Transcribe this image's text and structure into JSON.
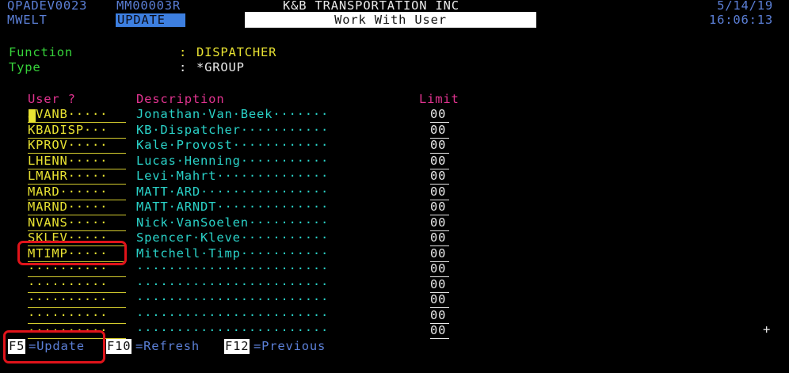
{
  "header": {
    "system_id": "QPADEV0023",
    "program_id": "MM00003R",
    "company": "K&B TRANSPORTATION INC",
    "date": "5/14/19",
    "user_id": "MWELT",
    "mode": "UPDATE",
    "screen_title": "Work With User",
    "time": "16:06:13"
  },
  "function": {
    "label": "Function",
    "colon": ":",
    "value": "DISPATCHER"
  },
  "type": {
    "label": "Type",
    "colon": ":",
    "value": "*GROUP"
  },
  "columns": {
    "user": "User ?",
    "description": "Description",
    "limit": "Limit"
  },
  "rows": [
    {
      "user": "JVANB·····",
      "description": "Jonathan·Van·Beek·······",
      "limit": "00"
    },
    {
      "user": "KBADISP···",
      "description": "KB·Dispatcher···········",
      "limit": "00"
    },
    {
      "user": "KPROV·····",
      "description": "Kale·Provost············",
      "limit": "00"
    },
    {
      "user": "LHENN·····",
      "description": "Lucas·Henning···········",
      "limit": "00"
    },
    {
      "user": "LMAHR·····",
      "description": "Levi·Mahrt··············",
      "limit": "00"
    },
    {
      "user": "MARD······",
      "description": "MATT·ARD················",
      "limit": "00"
    },
    {
      "user": "MARND·····",
      "description": "MATT·ARNDT··············",
      "limit": "00"
    },
    {
      "user": "NVANS·····",
      "description": "Nick·VanSoelen··········",
      "limit": "00"
    },
    {
      "user": "SKLEV·····",
      "description": "Spencer·Kleve···········",
      "limit": "00"
    },
    {
      "user": "MTIMP·····",
      "description": "Mitchell·Timp···········",
      "limit": "00"
    },
    {
      "user": "··········",
      "description": "························",
      "limit": "00"
    },
    {
      "user": "··········",
      "description": "························",
      "limit": "00"
    },
    {
      "user": "··········",
      "description": "························",
      "limit": "00"
    },
    {
      "user": "··········",
      "description": "························",
      "limit": "00"
    },
    {
      "user": "··········",
      "description": "························",
      "limit": "00"
    }
  ],
  "more_indicator": "+",
  "function_keys": [
    {
      "key": "F5",
      "label": "=Update"
    },
    {
      "key": "F10",
      "label": "=Refresh"
    },
    {
      "key": "F12",
      "label": "=Previous"
    }
  ],
  "colors": {
    "background": "#000000",
    "header_text": "#5b7fd6",
    "label_green": "#36d23a",
    "input_yellow": "#e8e232",
    "description_turquoise": "#2ad2c8",
    "column_header_pink": "#e0338f",
    "highlight_red": "#e0131a"
  }
}
